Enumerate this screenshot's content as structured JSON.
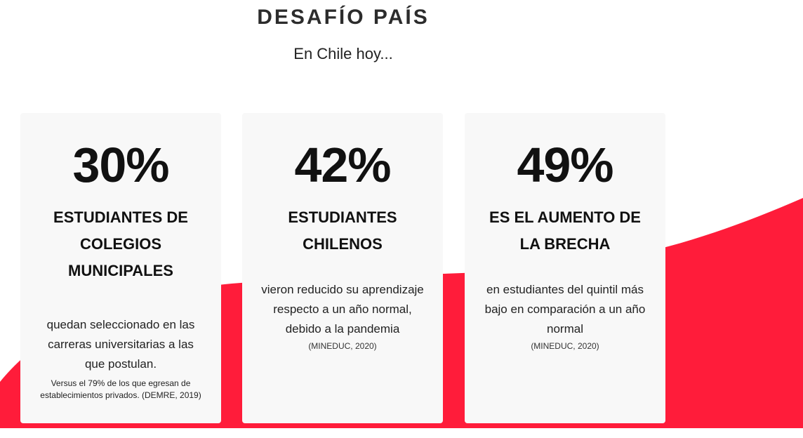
{
  "page": {
    "title": "DESAFÍO PAÍS",
    "subtitle": "En Chile hoy...",
    "accent_color": "#ff1c3a",
    "card_bg": "#f8f8f8"
  },
  "cards": [
    {
      "percent": "30%",
      "heading_lines": [
        "ESTUDIANTES DE",
        "COLEGIOS",
        "MUNICIPALES"
      ],
      "body_lines": [
        "quedan seleccionado en las",
        "carreras universitarias a las",
        "que postulan."
      ],
      "note_lines": [
        "Versus el 79% de los que egresan de",
        "establecimientos privados. (DEMRE, 2019)"
      ]
    },
    {
      "percent": "42%",
      "heading_lines": [
        "ESTUDIANTES",
        "CHILENOS"
      ],
      "body_lines": [
        "vieron reducido su aprendizaje",
        "respecto a un año normal,",
        "debido a la pandemia"
      ],
      "source": "(MINEDUC, 2020)"
    },
    {
      "percent": "49%",
      "heading_lines": [
        "ES EL AUMENTO DE",
        "LA BRECHA"
      ],
      "body_lines": [
        "en estudiantes del quintil más",
        "bajo en comparación a un año",
        "normal"
      ],
      "source": "(MINEDUC, 2020)"
    }
  ]
}
